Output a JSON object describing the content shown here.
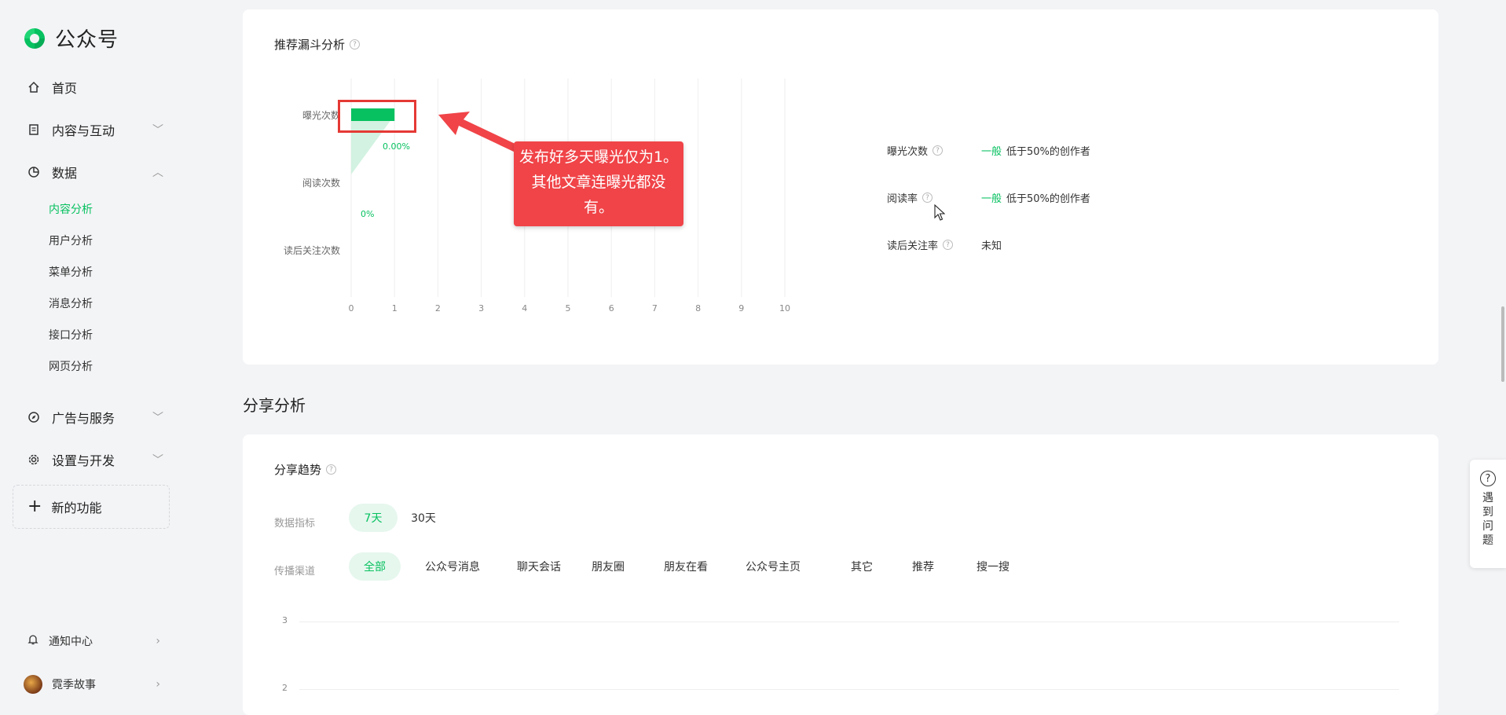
{
  "app": {
    "title": "公众号"
  },
  "sidebar": {
    "items": [
      {
        "label": "首页",
        "icon": "home-icon"
      },
      {
        "label": "内容与互动",
        "icon": "document-icon"
      },
      {
        "label": "数据",
        "icon": "pie-chart-icon"
      },
      {
        "label": "广告与服务",
        "icon": "compass-icon"
      },
      {
        "label": "设置与开发",
        "icon": "gear-icon"
      }
    ],
    "data_sub": [
      {
        "label": "内容分析",
        "active": true
      },
      {
        "label": "用户分析"
      },
      {
        "label": "菜单分析"
      },
      {
        "label": "消息分析"
      },
      {
        "label": "接口分析"
      },
      {
        "label": "网页分析"
      }
    ],
    "new_feature": "新的功能",
    "notifications": "通知中心",
    "account": "霓季故事"
  },
  "funnel_card": {
    "title": "推荐漏斗分析",
    "metrics": [
      {
        "label": "曝光次数",
        "level": "一般",
        "desc": "低于50%的创作者"
      },
      {
        "label": "阅读率",
        "level": "一般",
        "desc": "低于50%的创作者"
      },
      {
        "label": "读后关注率",
        "level": "",
        "desc": "未知"
      }
    ]
  },
  "chart_data": {
    "type": "bar",
    "categories": [
      "曝光次数",
      "阅读次数",
      "读后关注次数"
    ],
    "values": [
      1,
      0,
      0
    ],
    "conversion_labels": [
      "0.00%",
      "0%"
    ],
    "xticks": [
      "0",
      "1",
      "2",
      "3",
      "4",
      "5",
      "6",
      "7",
      "8",
      "9",
      "10"
    ],
    "xlim": [
      0,
      10
    ],
    "grid": true,
    "colors": {
      "bar": "#07c160",
      "funnel": "#c8efd9"
    }
  },
  "annotation": {
    "line1": "发布好多天曝光仅为1。",
    "line2": "其他文章连曝光都没",
    "line3": "有。"
  },
  "share_section": {
    "title": "分享分析",
    "card_title": "分享趋势",
    "metric_label": "数据指标",
    "periods": [
      "7天",
      "30天"
    ],
    "channel_label": "传播渠道",
    "channels": [
      "全部",
      "公众号消息",
      "聊天会话",
      "朋友圈",
      "朋友在看",
      "公众号主页",
      "其它",
      "推荐",
      "搜一搜"
    ],
    "yticks": [
      "3",
      "2"
    ]
  },
  "help": {
    "label": "遇到问题"
  }
}
